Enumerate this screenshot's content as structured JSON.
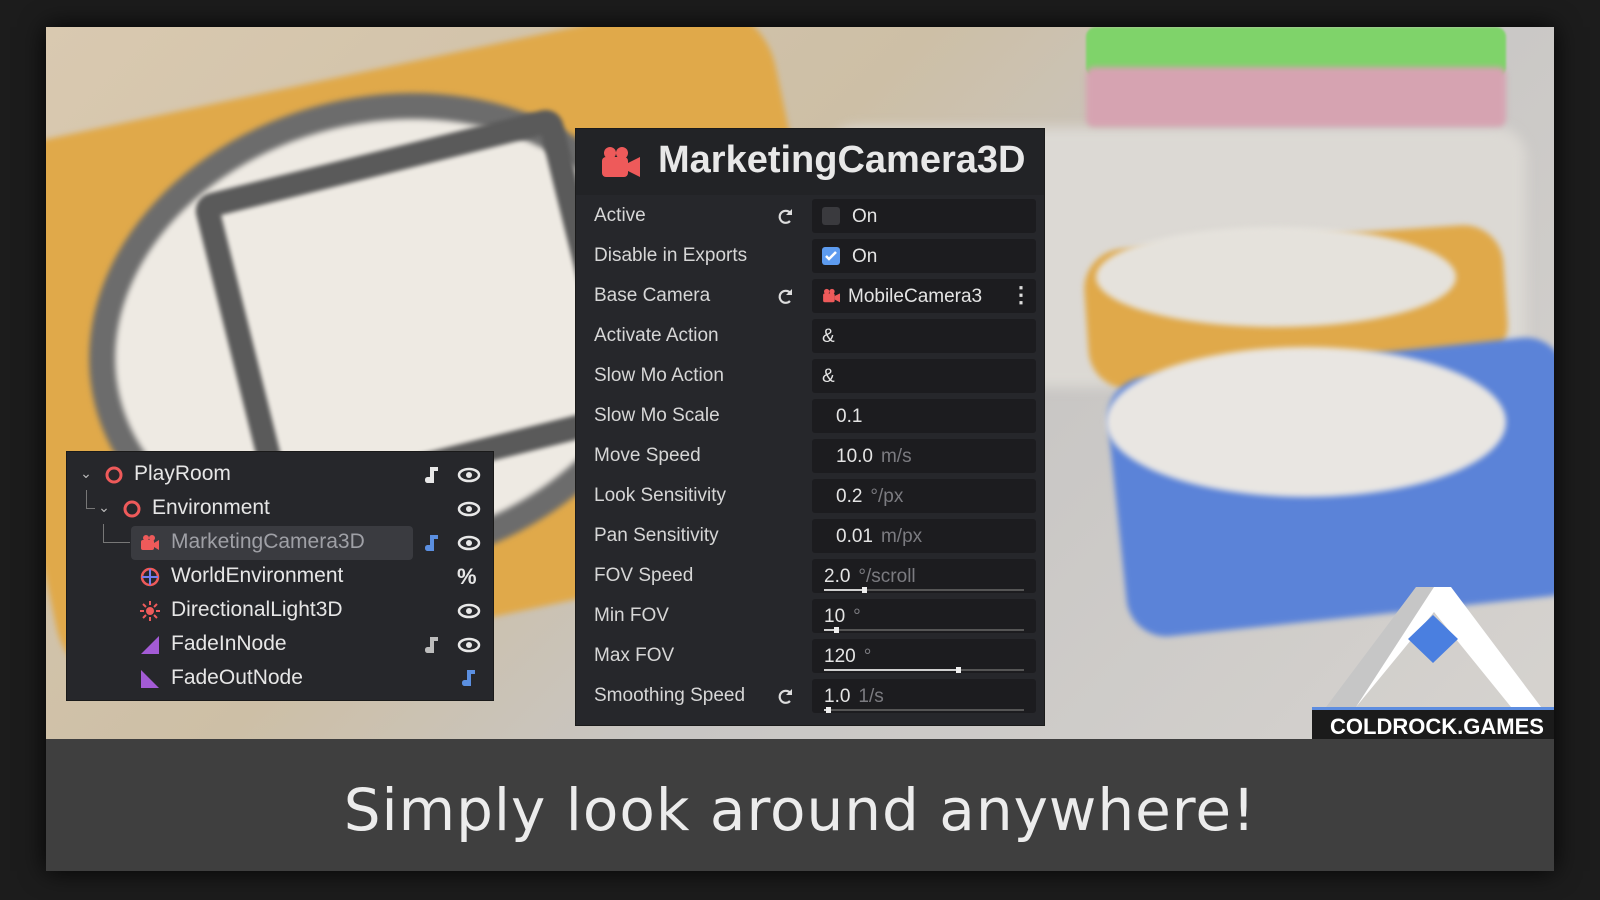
{
  "caption": "Simply look around anywhere!",
  "logo": {
    "text": "COLDROCK.GAMES",
    "accent": "#4a7fe0"
  },
  "scene_tree": {
    "items": [
      {
        "label": "PlayRoom",
        "icon": "node-ring-icon",
        "color": "#ee5a5a"
      },
      {
        "label": "Environment",
        "icon": "node-ring-icon",
        "color": "#ee5a5a"
      },
      {
        "label": "MarketingCamera3D",
        "icon": "camera-icon",
        "color": "#ee5a5a"
      },
      {
        "label": "WorldEnvironment",
        "icon": "globe-icon",
        "color": "#ee5a5a"
      },
      {
        "label": "DirectionalLight3D",
        "icon": "sun-icon",
        "color": "#ee5a5a"
      },
      {
        "label": "FadeInNode",
        "icon": "triangle-icon",
        "color": "#a35bd6"
      },
      {
        "label": "FadeOutNode",
        "icon": "triangle-icon",
        "color": "#a35bd6"
      }
    ],
    "percent_symbol": "%"
  },
  "inspector": {
    "title": "MarketingCamera3D",
    "properties": [
      {
        "label": "Active",
        "value": "On",
        "checked": false
      },
      {
        "label": "Disable in Exports",
        "value": "On",
        "checked": true
      },
      {
        "label": "Base Camera",
        "value": "MobileCamera3"
      },
      {
        "label": "Activate Action",
        "value": "&"
      },
      {
        "label": "Slow Mo Action",
        "value": "&"
      },
      {
        "label": "Slow Mo Scale",
        "value": "0.1",
        "unit": ""
      },
      {
        "label": "Move Speed",
        "value": "10.0",
        "unit": "m/s"
      },
      {
        "label": "Look Sensitivity",
        "value": "0.2",
        "unit": "°/px"
      },
      {
        "label": "Pan Sensitivity",
        "value": "0.01",
        "unit": "m/px"
      },
      {
        "label": "FOV Speed",
        "value": "2.0",
        "unit": "°/scroll",
        "slider": 0.2
      },
      {
        "label": "Min FOV",
        "value": "10",
        "unit": "°",
        "slider": 0.06
      },
      {
        "label": "Max FOV",
        "value": "120",
        "unit": "°",
        "slider": 0.67
      },
      {
        "label": "Smoothing Speed",
        "value": "1.0",
        "unit": "1/s",
        "slider": 0.02
      }
    ]
  }
}
